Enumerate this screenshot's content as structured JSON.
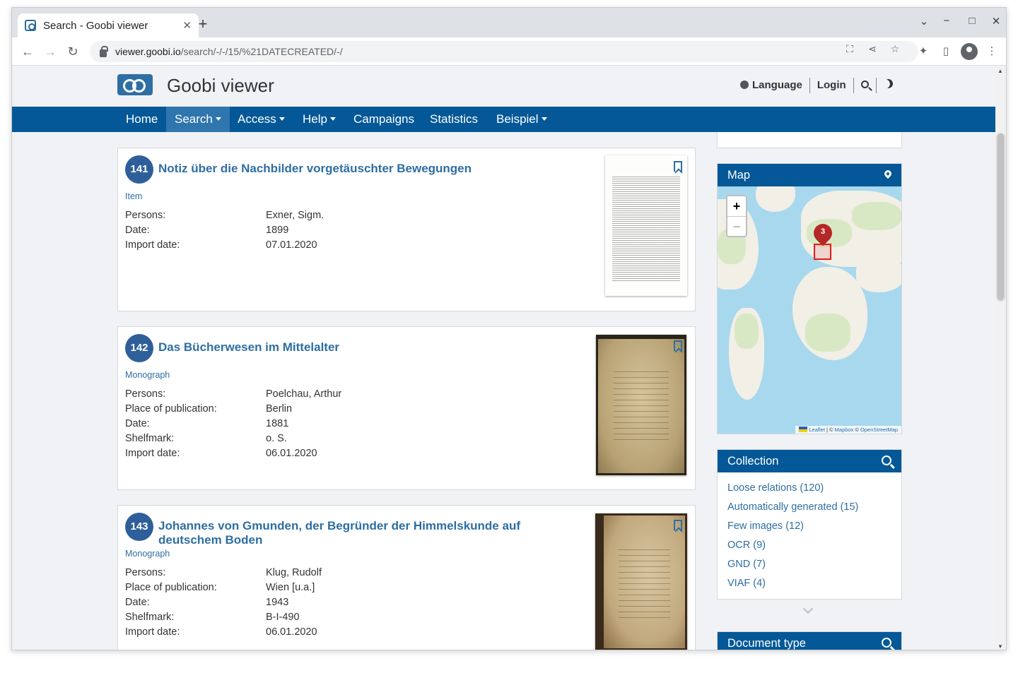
{
  "browser": {
    "tab_title": "Search - Goobi viewer",
    "tab_close": "✕",
    "new_tab": "+",
    "url_host": "viewer.goobi.io",
    "url_path": "/search/-/-/15/%21DATECREATED/-/"
  },
  "site": {
    "title": "Goobi viewer",
    "language": "Language",
    "login": "Login"
  },
  "nav": {
    "home": "Home",
    "search": "Search",
    "access": "Access",
    "help": "Help",
    "campaigns": "Campaigns",
    "statistics": "Statistics",
    "beispiel": "Beispiel"
  },
  "results": [
    {
      "number": "141",
      "title": "Notiz über die Nachbilder vorgetäuschter Bewegungen",
      "type": "Item",
      "fields": [
        {
          "label": "Persons:",
          "value": "Exner, Sigm."
        },
        {
          "label": "Date:",
          "value": "1899"
        },
        {
          "label": "Import date:",
          "value": "07.01.2020"
        }
      ]
    },
    {
      "number": "142",
      "title": "Das Bücherwesen im Mittelalter",
      "type": "Monograph",
      "fields": [
        {
          "label": "Persons:",
          "value": "Poelchau, Arthur"
        },
        {
          "label": "Place of publication:",
          "value": "Berlin"
        },
        {
          "label": "Date:",
          "value": "1881"
        },
        {
          "label": "Shelfmark:",
          "value": "o. S."
        },
        {
          "label": "Import date:",
          "value": "06.01.2020"
        }
      ]
    },
    {
      "number": "143",
      "title": "Johannes von Gmunden, der Begründer der Himmelskunde auf deutschem Boden",
      "type": "Monograph",
      "fields": [
        {
          "label": "Persons:",
          "value": "Klug, Rudolf"
        },
        {
          "label": "Place of publication:",
          "value": "Wien [u.a.]"
        },
        {
          "label": "Date:",
          "value": "1943"
        },
        {
          "label": "Shelfmark:",
          "value": "B-I-490"
        },
        {
          "label": "Import date:",
          "value": "06.01.2020"
        }
      ]
    }
  ],
  "sidebar": {
    "map": {
      "title": "Map",
      "zoom_in": "+",
      "zoom_out": "−",
      "cluster_count": "3",
      "attribution_leaflet": "Leaflet",
      "attribution_sep": " | © ",
      "attribution_mapbox": "Mapbox",
      "attribution_osm_prefix": " © ",
      "attribution_osm": "OpenStreetMap"
    },
    "collection": {
      "title": "Collection",
      "items": [
        "Loose relations (120)",
        "Automatically generated (15)",
        "Few images (12)",
        "OCR (9)",
        "GND (7)",
        "VIAF (4)"
      ]
    },
    "document_type": {
      "title": "Document type"
    }
  },
  "colors": {
    "nav_bg": "#045897",
    "nav_active": "#2f75ae",
    "link": "#2e6ea3",
    "hit_badge": "#2e5f9a",
    "marker": "#b52828"
  },
  "icons": [
    "favicon-icon",
    "back-icon",
    "forward-icon",
    "reload-icon",
    "lock-icon",
    "translate-icon",
    "share-icon",
    "star-icon",
    "extensions-icon",
    "sidepanel-icon",
    "profile-icon",
    "menu-icon",
    "globe-icon",
    "search-icon",
    "moon-icon",
    "bookmark-icon",
    "map-pin-icon",
    "chevron-down-icon"
  ]
}
